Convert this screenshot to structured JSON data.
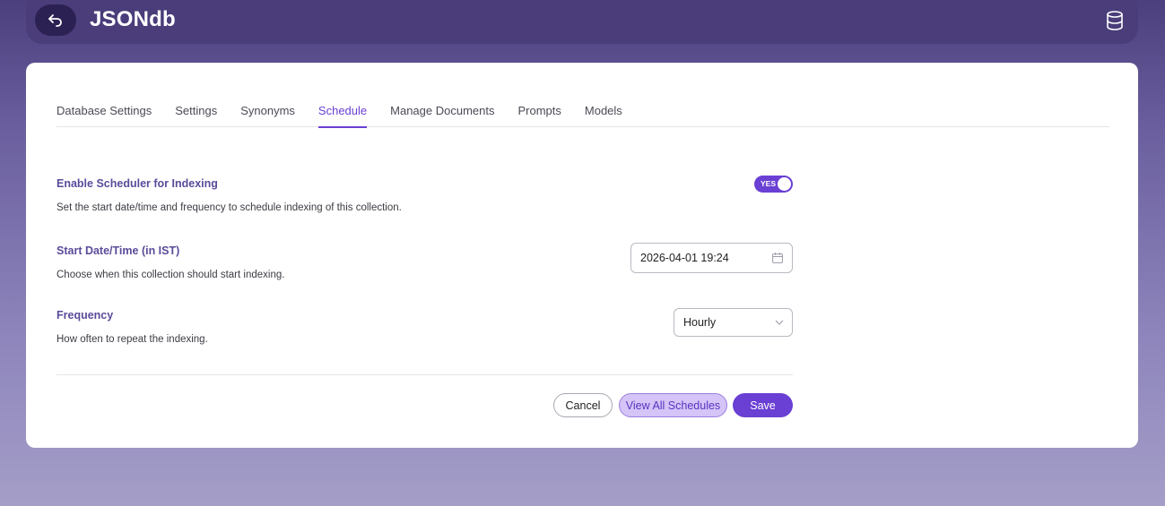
{
  "app": {
    "title": "JSONdb"
  },
  "header": {
    "back_icon": "back-arrow-icon",
    "db_icon": "database-icon"
  },
  "tabs": [
    {
      "label": "Database Settings",
      "active": false
    },
    {
      "label": "Settings",
      "active": false
    },
    {
      "label": "Synonyms",
      "active": false
    },
    {
      "label": "Schedule",
      "active": true
    },
    {
      "label": "Manage Documents",
      "active": false
    },
    {
      "label": "Prompts",
      "active": false
    },
    {
      "label": "Models",
      "active": false
    }
  ],
  "scheduler": {
    "title": "Enable Scheduler for Indexing",
    "description": "Set the start date/time and frequency to schedule indexing of this collection.",
    "toggle_label": "YES",
    "enabled": true
  },
  "start": {
    "title": "Start Date/Time (in IST)",
    "description": "Choose when this collection should start indexing.",
    "value": "2026-04-01 19:24"
  },
  "frequency": {
    "title": "Frequency",
    "description": "How often to repeat the indexing.",
    "value": "Hourly"
  },
  "actions": {
    "cancel": "Cancel",
    "view_all": "View All Schedules",
    "save": "Save"
  },
  "colors": {
    "accent": "#6a3fd3",
    "header_bg": "#4a3d7a",
    "field_title": "#5b4b9a"
  }
}
